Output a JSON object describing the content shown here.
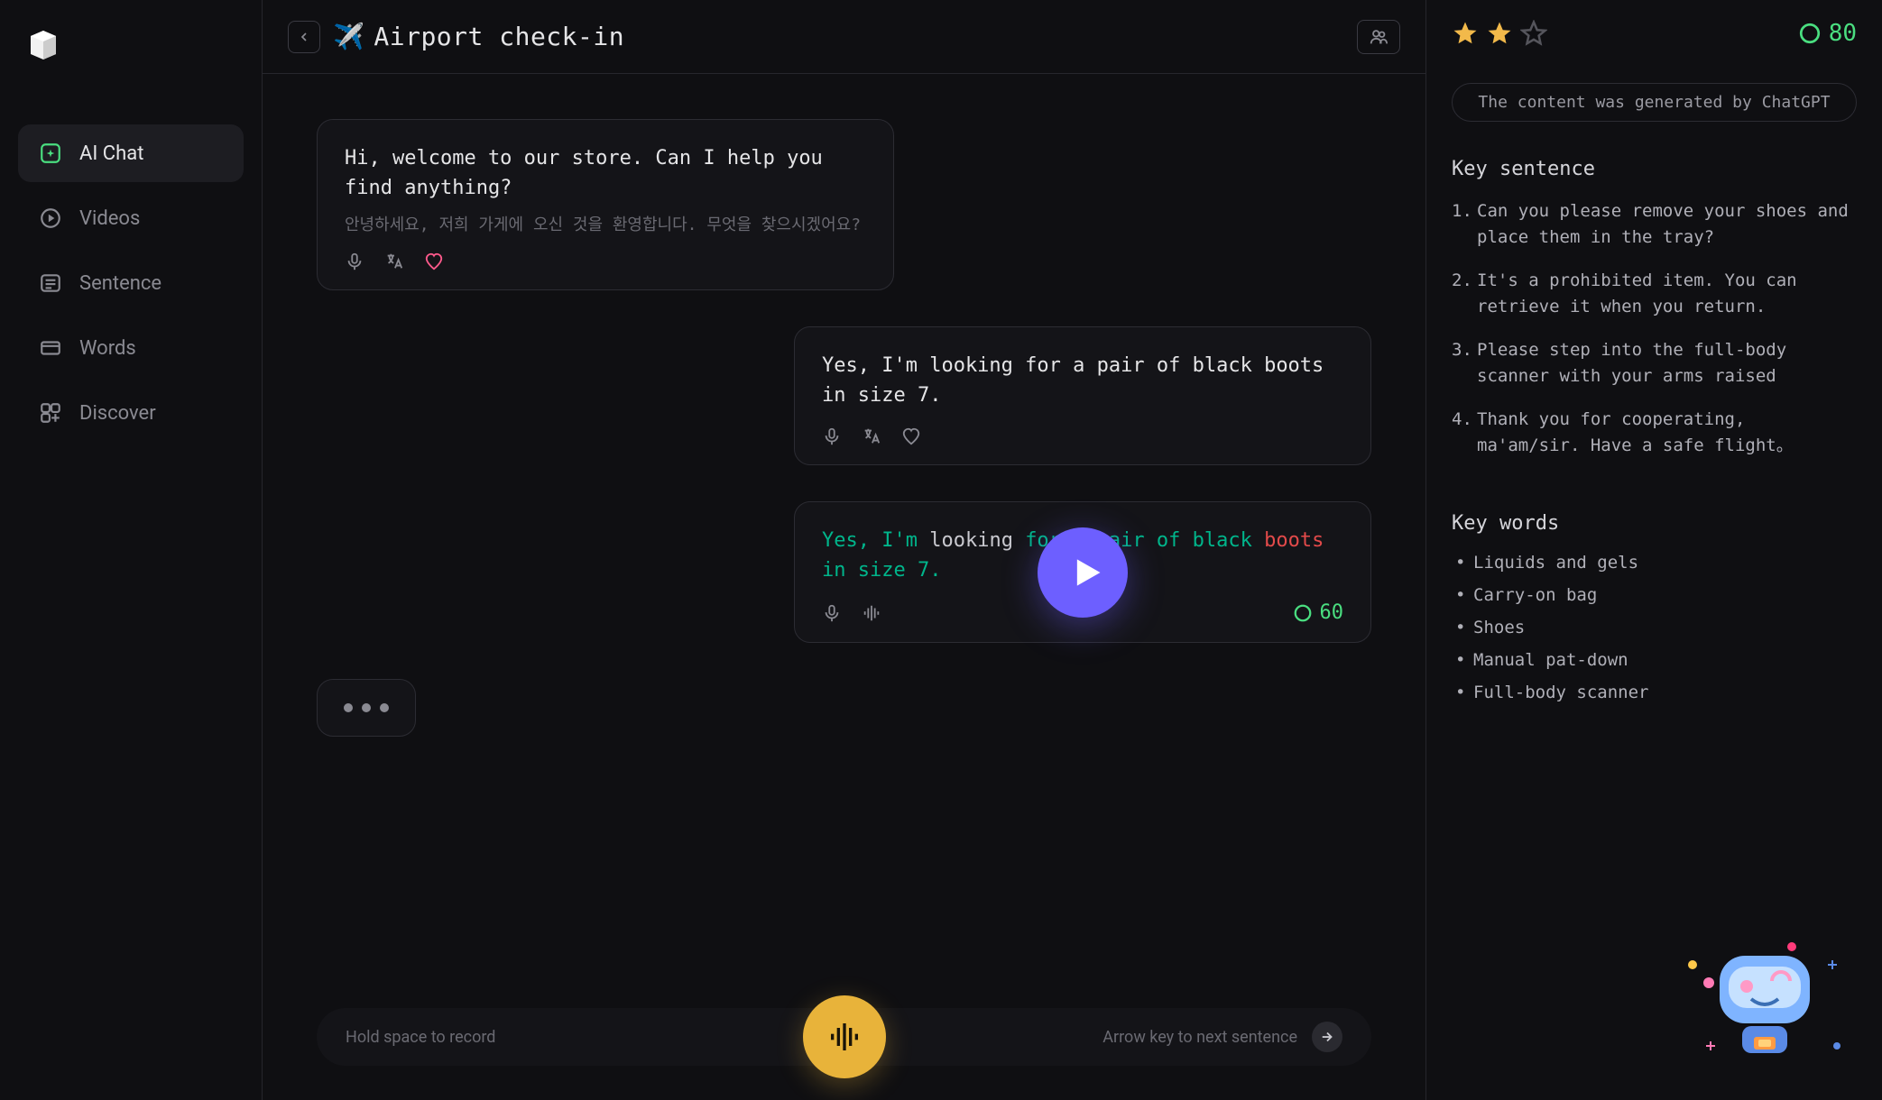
{
  "nav": {
    "items": [
      {
        "label": "AI Chat"
      },
      {
        "label": "Videos"
      },
      {
        "label": "Sentence"
      },
      {
        "label": "Words"
      },
      {
        "label": "Discover"
      }
    ]
  },
  "topbar": {
    "emoji": "✈️",
    "title": "Airport check-in"
  },
  "conversation": {
    "system": {
      "text": "Hi, welcome to our store. Can I help you find anything?",
      "sub": "안녕하세요, 저희 가게에 오신 것을 환영합니다. 무엇을 찾으시겠어요?"
    },
    "user": {
      "text": "Yes, I'm looking for a pair of black boots in size 7."
    },
    "practice": {
      "tokens": [
        {
          "t": "Yes,",
          "c": "green"
        },
        {
          "t": "I'm",
          "c": "green"
        },
        {
          "t": "looking",
          "c": "plain"
        },
        {
          "t": "for",
          "c": "green"
        },
        {
          "t": "a",
          "c": "green"
        },
        {
          "t": "pair",
          "c": "green"
        },
        {
          "t": "of",
          "c": "green"
        },
        {
          "t": "black",
          "c": "green"
        },
        {
          "t": "boots",
          "c": "red"
        },
        {
          "t": "in",
          "c": "green"
        },
        {
          "t": "size",
          "c": "green"
        },
        {
          "t": "7.",
          "c": "green"
        }
      ],
      "score": "60"
    }
  },
  "footer": {
    "left": "Hold space to record",
    "right": "Arrow key to next sentence"
  },
  "right": {
    "overall_score": "80",
    "gen_notice": "The content was generated by ChatGPT",
    "key_sentence_title": "Key sentence",
    "key_sentences": [
      "Can you please remove your shoes and place them in the tray?",
      "It's a prohibited item. You can retrieve it when you return.",
      "Please step into the full-body scanner with your arms raised",
      "Thank you for cooperating, ma'am/sir. Have a safe flight。"
    ],
    "key_words_title": "Key words",
    "key_words": [
      "Liquids and gels",
      "Carry-on bag",
      "Shoes",
      "Manual pat-down",
      "Full-body scanner"
    ]
  }
}
